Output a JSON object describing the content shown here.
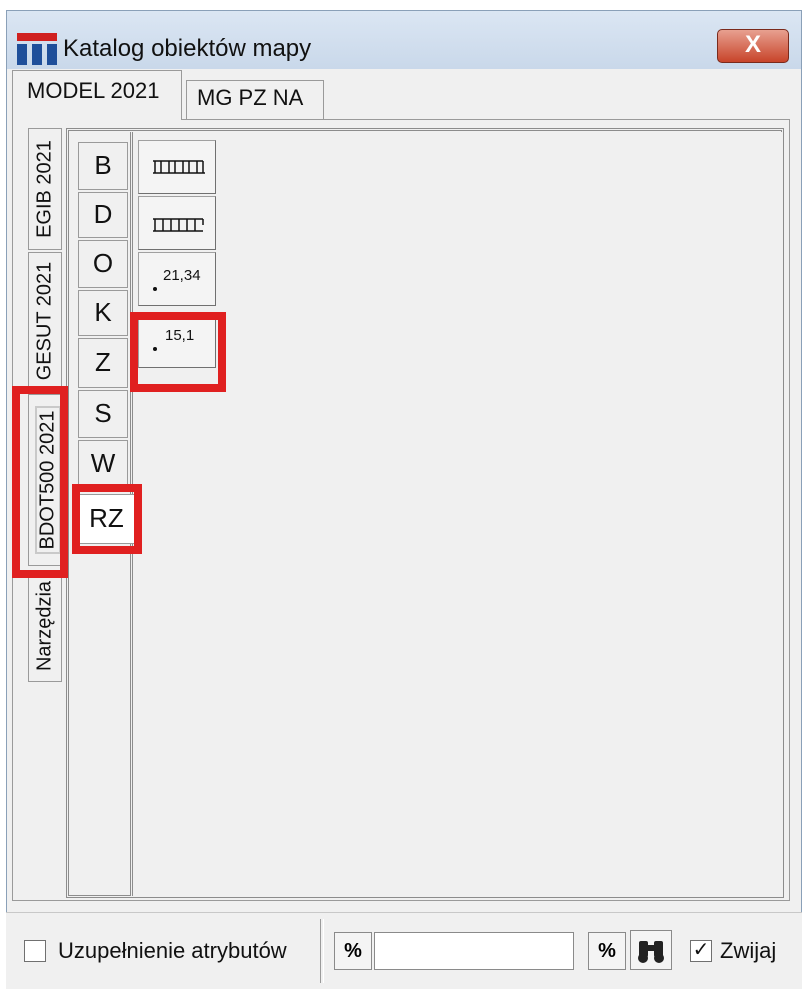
{
  "window": {
    "title": "Katalog obiektów mapy",
    "close_glyph": "X"
  },
  "top_tabs": [
    {
      "label": "MODEL 2021"
    },
    {
      "label": "MG PZ NA"
    }
  ],
  "side_tabs": [
    {
      "label": "EGIB 2021"
    },
    {
      "label": "GESUT 2021"
    },
    {
      "label": "BDOT500 2021"
    },
    {
      "label": "Narzędzia"
    }
  ],
  "selected_side_tab": "BDOT500 2021",
  "letter_tabs": [
    {
      "label": "B"
    },
    {
      "label": "D"
    },
    {
      "label": "O"
    },
    {
      "label": "K"
    },
    {
      "label": "Z"
    },
    {
      "label": "S"
    },
    {
      "label": "W"
    },
    {
      "label": "RZ"
    }
  ],
  "selected_letter_tab": "RZ",
  "symbols": [
    {
      "icon": "fence-pattern-icon-1",
      "label": ""
    },
    {
      "icon": "fence-pattern-icon-2",
      "label": ""
    },
    {
      "icon": "elevation-point-icon",
      "label": "21,34"
    },
    {
      "icon": "elevation-point-icon",
      "label": "15,1"
    }
  ],
  "highlight_color": "#e02020",
  "status": {
    "attributes_checkbox_label": "Uzupełnienie atrybutów",
    "attributes_checked": false,
    "pct_left_label": "%",
    "search_value": "",
    "pct_right_label": "%",
    "binoculars_icon": "binoculars-icon",
    "collapse_label": "Zwijaj",
    "collapse_checked": true,
    "check_glyph": "✓"
  }
}
